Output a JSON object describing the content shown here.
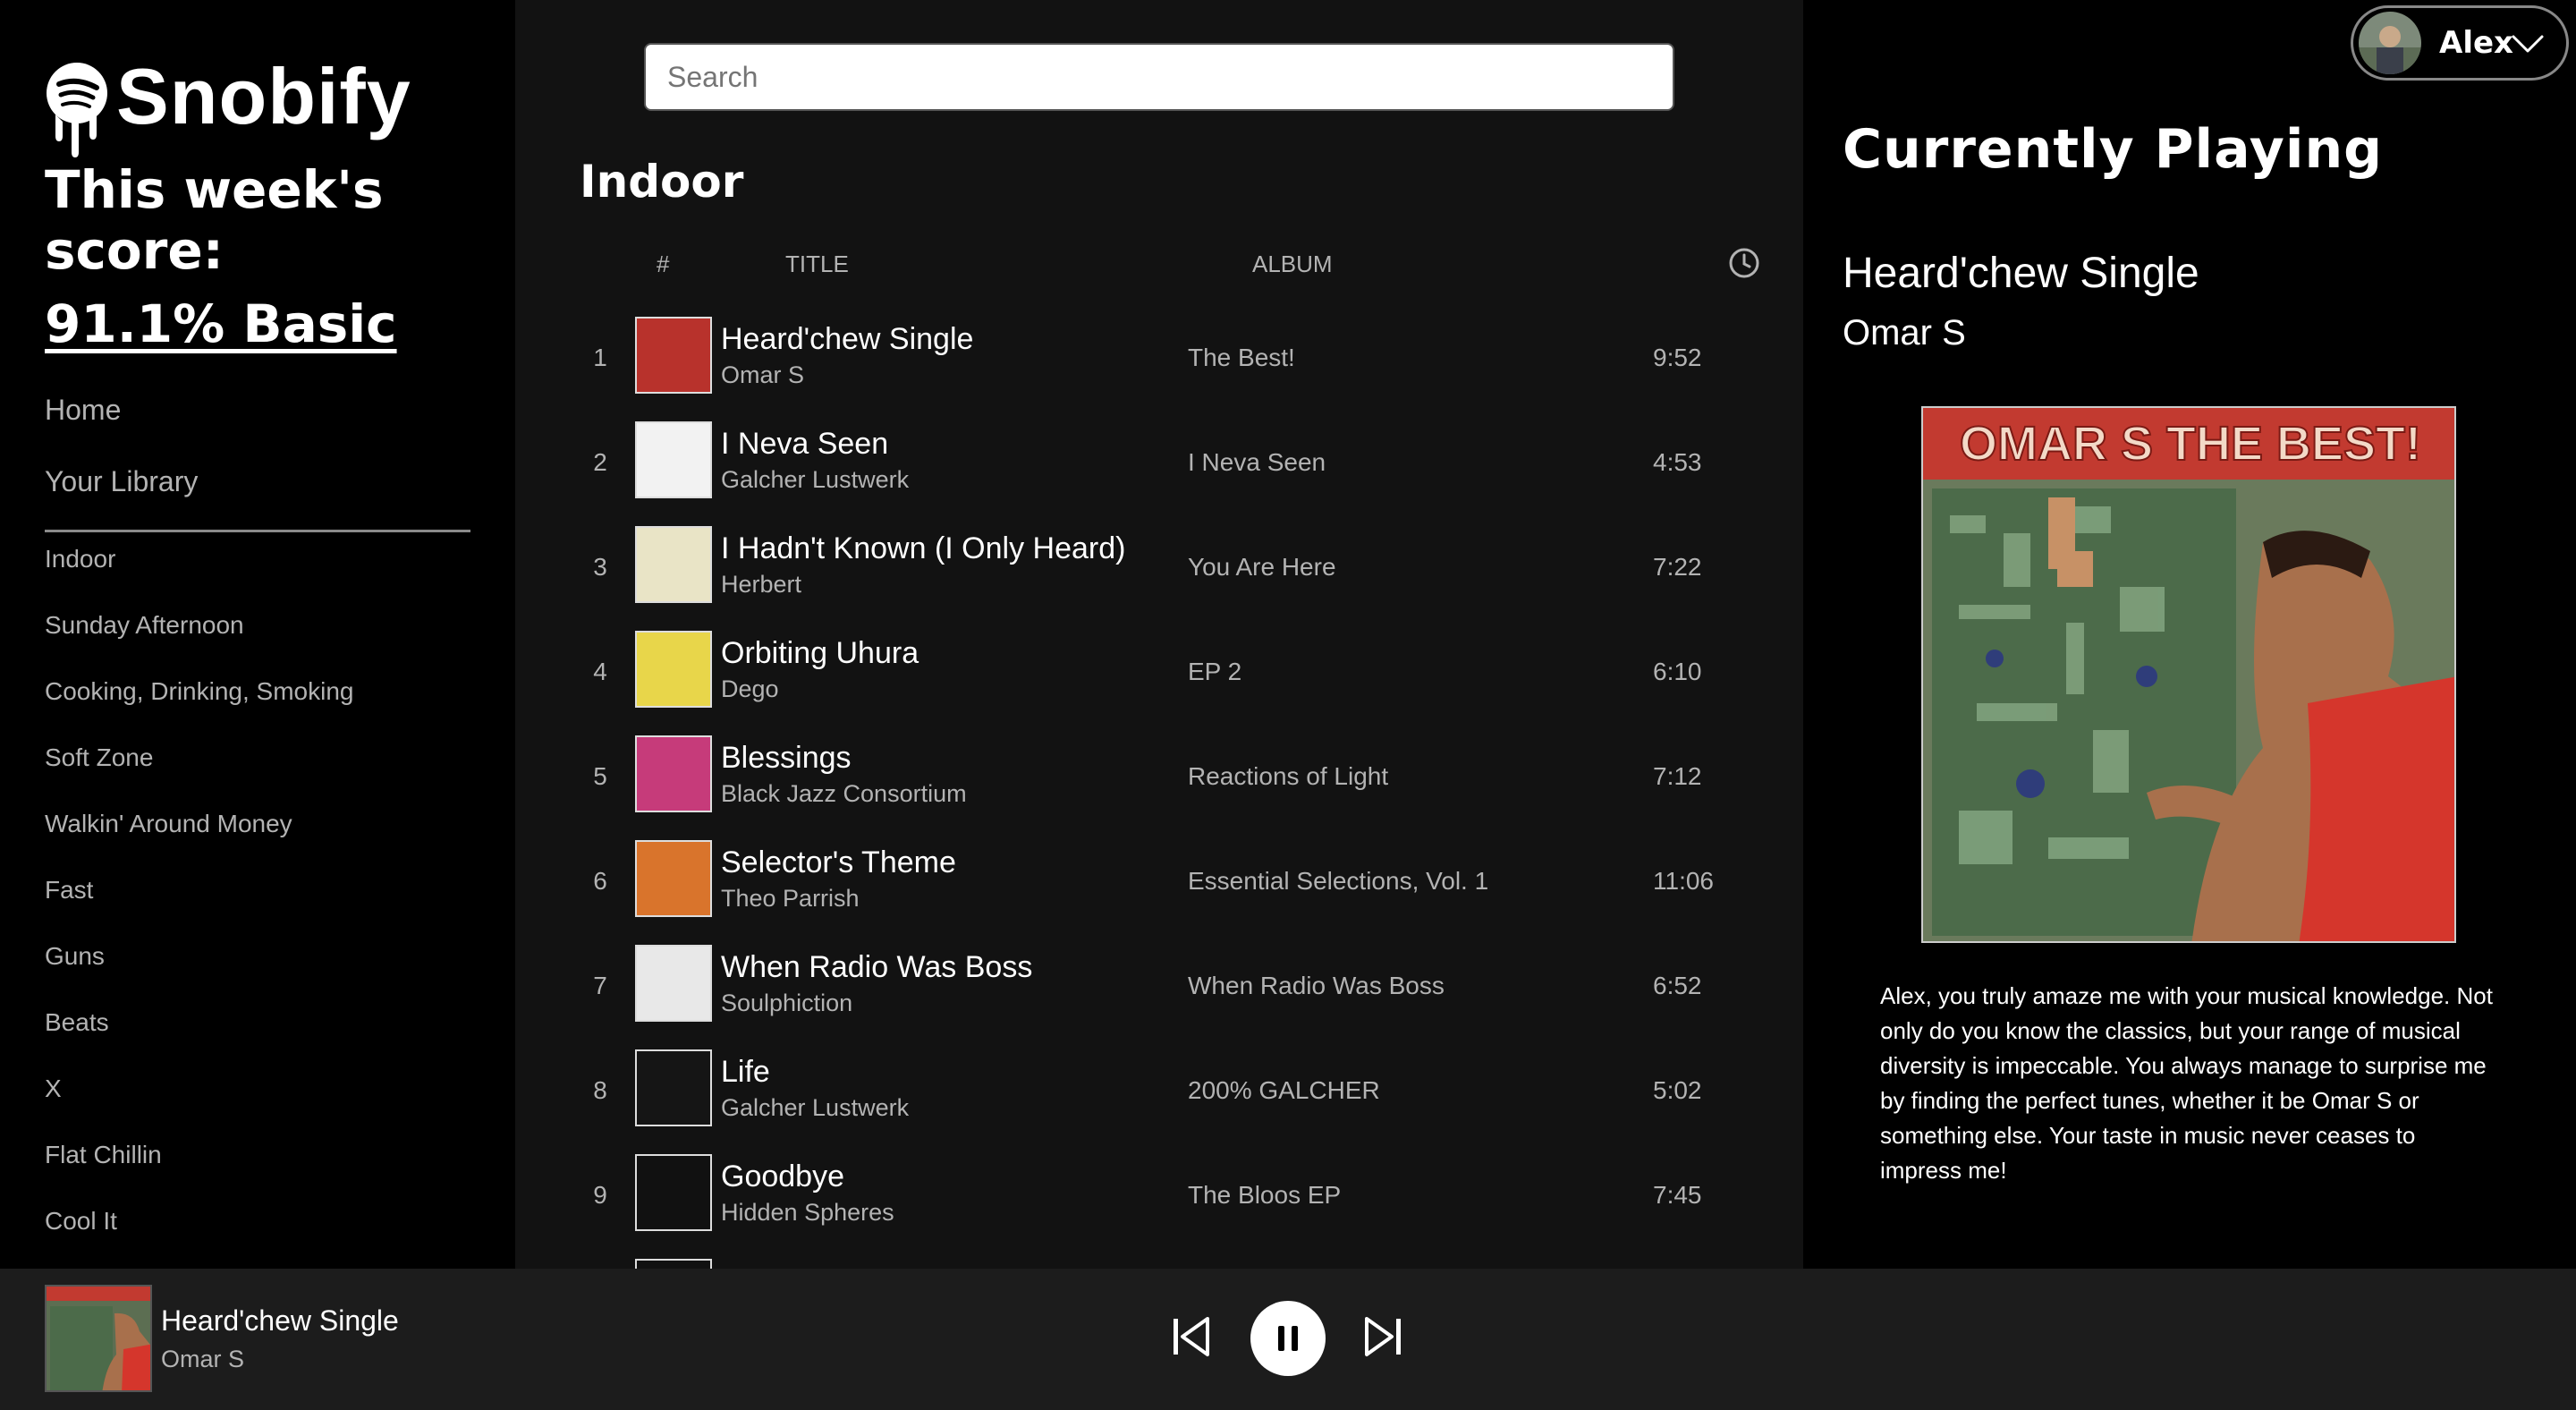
{
  "app": {
    "name": "Snobify"
  },
  "sidebar": {
    "score_label": "This week's score:",
    "score_value": "91.1% Basic",
    "nav": [
      {
        "label": "Home"
      },
      {
        "label": "Your Library"
      }
    ],
    "playlists": [
      {
        "label": "Indoor"
      },
      {
        "label": "Sunday Afternoon"
      },
      {
        "label": "Cooking, Drinking, Smoking"
      },
      {
        "label": "Soft Zone"
      },
      {
        "label": "Walkin' Around Money"
      },
      {
        "label": "Fast"
      },
      {
        "label": "Guns"
      },
      {
        "label": "Beats"
      },
      {
        "label": "X"
      },
      {
        "label": "Flat Chillin"
      },
      {
        "label": "Cool It"
      }
    ]
  },
  "main": {
    "search_placeholder": "Search",
    "playlist_title": "Indoor",
    "columns": {
      "num": "#",
      "title": "TITLE",
      "album": "ALBUM",
      "duration_icon": "clock-icon"
    },
    "tracks": [
      {
        "num": "1",
        "title": "Heard'chew Single",
        "artist": "Omar S",
        "album": "The Best!",
        "duration": "9:52",
        "art_color": "#b8322c"
      },
      {
        "num": "2",
        "title": "I Neva Seen",
        "artist": "Galcher Lustwerk",
        "album": "I Neva Seen",
        "duration": "4:53",
        "art_color": "#f2f2f2"
      },
      {
        "num": "3",
        "title": "I Hadn't Known (I Only Heard)",
        "artist": "Herbert",
        "album": "You Are Here",
        "duration": "7:22",
        "art_color": "#e9e4c6"
      },
      {
        "num": "4",
        "title": "Orbiting Uhura",
        "artist": "Dego",
        "album": "EP 2",
        "duration": "6:10",
        "art_color": "#e8d64a"
      },
      {
        "num": "5",
        "title": "Blessings",
        "artist": "Black Jazz Consortium",
        "album": "Reactions of Light",
        "duration": "7:12",
        "art_color": "#c63b7a"
      },
      {
        "num": "6",
        "title": "Selector's Theme",
        "artist": "Theo Parrish",
        "album": "Essential Selections, Vol. 1",
        "duration": "11:06",
        "art_color": "#d9742c"
      },
      {
        "num": "7",
        "title": "When Radio Was Boss",
        "artist": "Soulphiction",
        "album": "When Radio Was Boss",
        "duration": "6:52",
        "art_color": "#e8e8e8"
      },
      {
        "num": "8",
        "title": "Life",
        "artist": "Galcher Lustwerk",
        "album": "200% GALCHER",
        "duration": "5:02",
        "art_color": "#151515"
      },
      {
        "num": "9",
        "title": "Goodbye",
        "artist": "Hidden Spheres",
        "album": "The Bloos EP",
        "duration": "7:45",
        "art_color": "#111111"
      }
    ]
  },
  "right": {
    "user": {
      "name": "Alex"
    },
    "heading": "Currently Playing",
    "track_title": "Heard'chew Single",
    "track_artist": "Omar S",
    "comment": "Alex, you truly amaze me with your musical knowledge. Not only do you know the classics, but your range of musical diversity is impeccable. You always manage to surprise me by finding the perfect tunes, whether it be Omar S or something else. Your taste in music never ceases to impress me!",
    "cover_text": "OMAR S THE BEST!"
  },
  "player": {
    "title": "Heard'chew Single",
    "artist": "Omar S",
    "state": "playing",
    "controls": [
      "previous-icon",
      "pause-icon",
      "next-icon"
    ]
  },
  "colors": {
    "background": "#121212",
    "sidebar": "#000000",
    "player_bar": "#1c1c1c",
    "muted_text": "#b3b3b3"
  }
}
